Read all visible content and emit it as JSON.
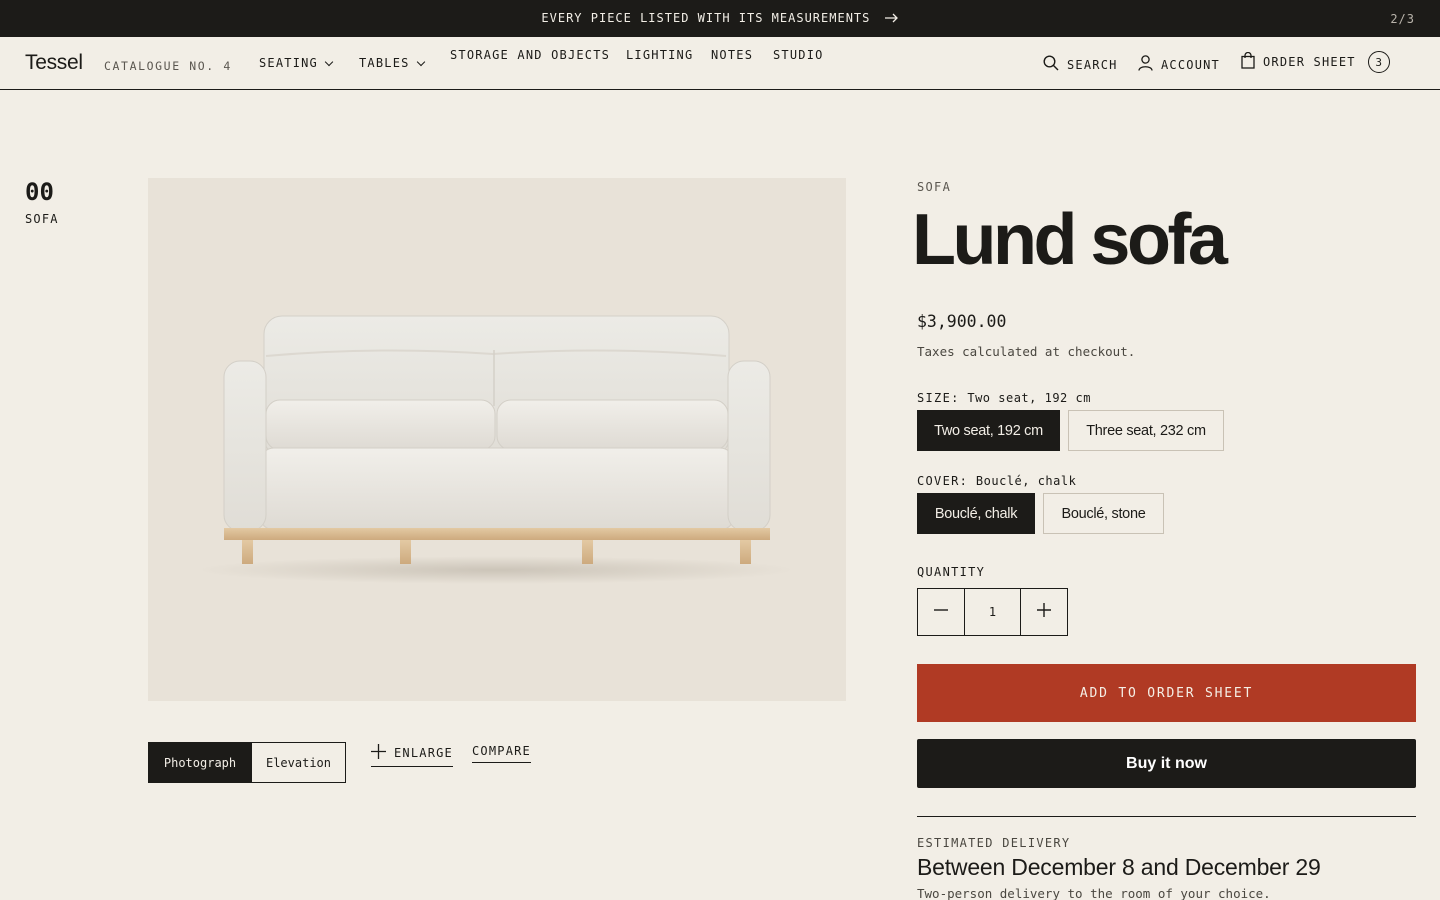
{
  "announcement": {
    "message": "EVERY PIECE LISTED WITH ITS MEASUREMENTS",
    "page": "2/3"
  },
  "header": {
    "logo": "Tessel",
    "catalogue": "CATALOGUE NO. 4",
    "nav": [
      "SEATING",
      "TABLES",
      "STORAGE AND OBJECTS",
      "LIGHTING",
      "NOTES",
      "STUDIO"
    ],
    "search": "SEARCH",
    "account": "ACCOUNT",
    "order_sheet": "ORDER SHEET",
    "order_count": "3"
  },
  "index": {
    "number": "00",
    "label": "SOFA"
  },
  "gallery": {
    "views": [
      "Photograph",
      "Elevation"
    ],
    "active_view": "Photograph",
    "enlarge": "ENLARGE",
    "compare": "COMPARE"
  },
  "product": {
    "category": "SOFA",
    "title": "Lund sofa",
    "price": "$3,900.00",
    "tax_note": "Taxes calculated at checkout.",
    "size": {
      "label": "SIZE:",
      "selected": "Two seat, 192 cm",
      "options": [
        "Two seat, 192 cm",
        "Three seat, 232 cm"
      ]
    },
    "cover": {
      "label": "COVER:",
      "selected": "Bouclé, chalk",
      "options": [
        "Bouclé, chalk",
        "Bouclé, stone"
      ]
    },
    "quantity_label": "QUANTITY",
    "quantity": "1",
    "add_to_order": "ADD TO ORDER SHEET",
    "buy_now": "Buy it now"
  },
  "delivery": {
    "label": "ESTIMATED DELIVERY",
    "range": "Between December 8 and December 29",
    "note": "Two-person delivery to the room of your choice."
  },
  "colors": {
    "accent": "#b03a24",
    "ink": "#1c1b18",
    "background": "#f2eee6",
    "image_bg": "#e8e2d8"
  }
}
